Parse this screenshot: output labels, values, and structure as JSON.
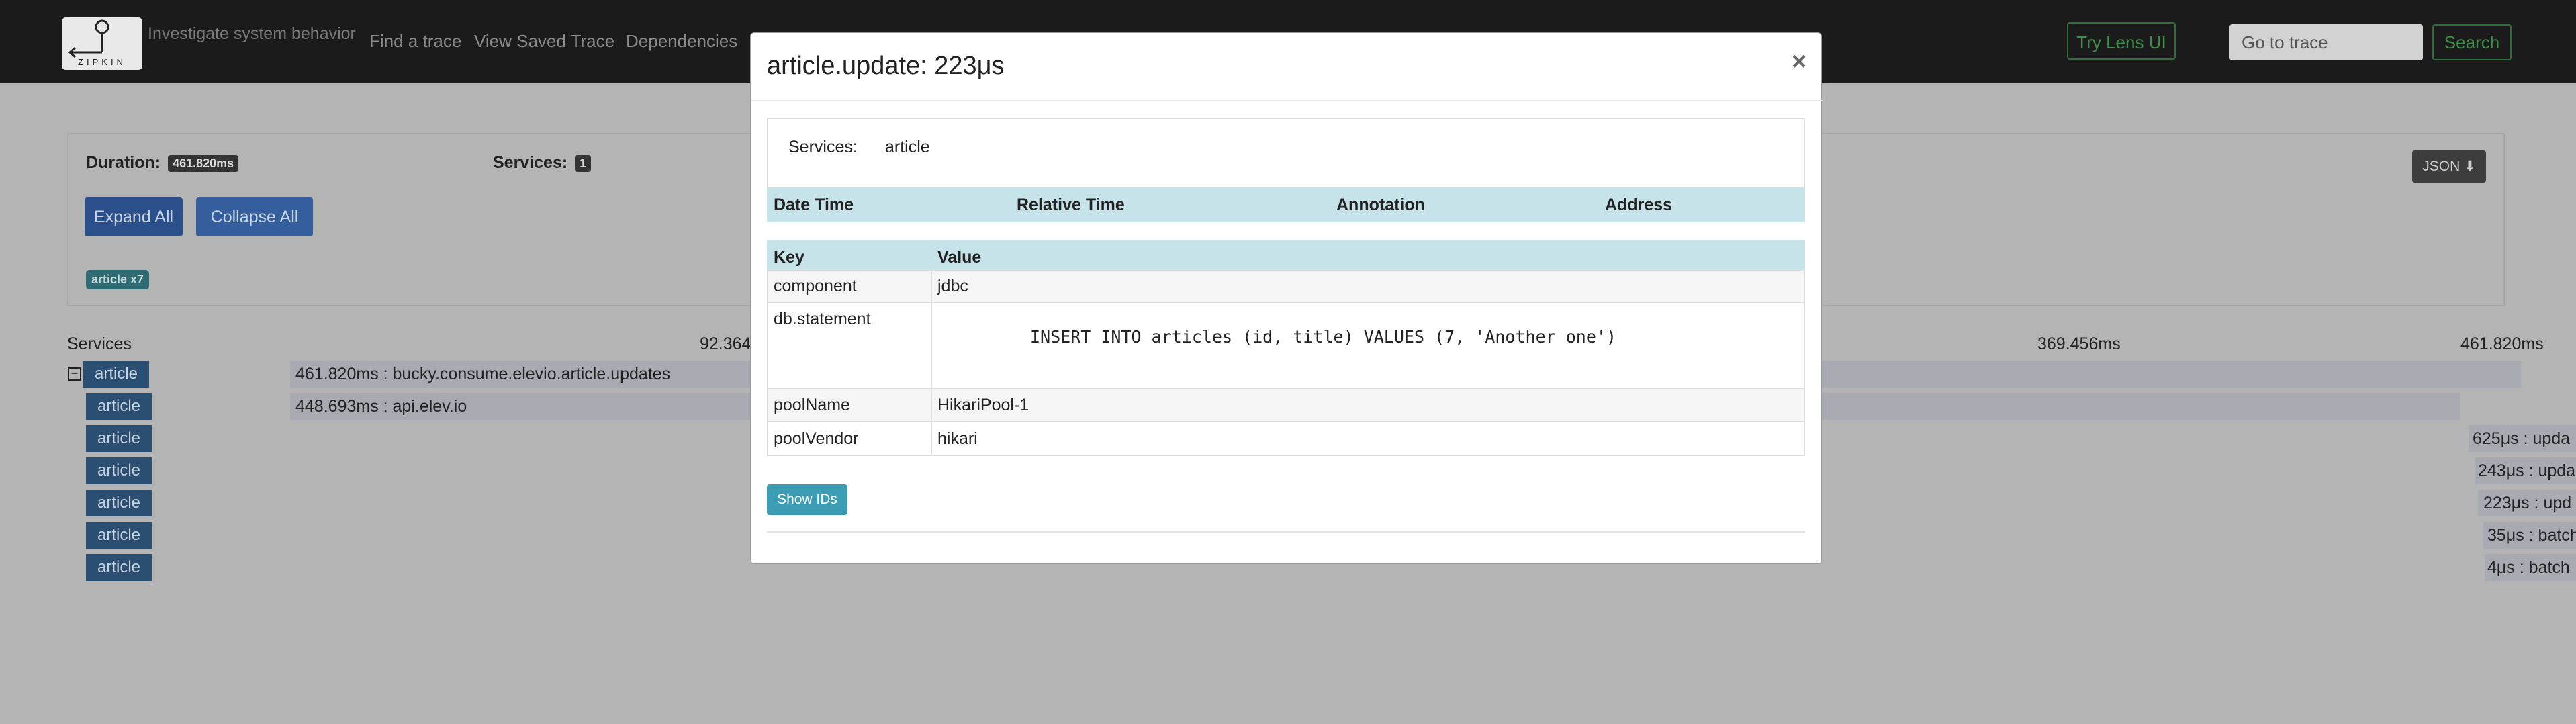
{
  "header": {
    "logo_text": "ZIPKIN",
    "tagline": "Investigate system behavior",
    "nav": [
      "Find a trace",
      "View Saved Trace",
      "Dependencies"
    ],
    "try_lens_label": "Try Lens UI",
    "goto_placeholder": "Go to trace",
    "search_label": "Search"
  },
  "summary": {
    "duration_label": "Duration:",
    "duration_value": "461.820ms",
    "services_label": "Services:",
    "services_value": "1",
    "expand_all_label": "Expand All",
    "collapse_all_label": "Collapse All",
    "service_badge": "article x7",
    "json_label": "JSON"
  },
  "timeline": {
    "services_header": "Services",
    "ticks": [
      "92.364",
      "369.456ms",
      "461.820ms"
    ],
    "rows": [
      {
        "service": "article",
        "text": "461.820ms : bucky.consume.elevio.article.updates"
      },
      {
        "service": "article",
        "text": "448.693ms : api.elev.io"
      },
      {
        "service": "article",
        "text": "625μs : upda"
      },
      {
        "service": "article",
        "text": "243μs : upda"
      },
      {
        "service": "article",
        "text": "223μs : upd"
      },
      {
        "service": "article",
        "text": "35μs : batch"
      },
      {
        "service": "article",
        "text": "4μs : batch"
      }
    ]
  },
  "modal": {
    "title": "article.update: 223μs",
    "close": "×",
    "services_key": "Services:",
    "services_value": "article",
    "annotation_headers": [
      "Date Time",
      "Relative Time",
      "Annotation",
      "Address"
    ],
    "tag_headers": [
      "Key",
      "Value"
    ],
    "tags": [
      {
        "key": "component",
        "value": "jdbc"
      },
      {
        "key": "db.statement",
        "value": "INSERT INTO articles (id, title) VALUES (7, 'Another one')"
      },
      {
        "key": "poolName",
        "value": "HikariPool-1"
      },
      {
        "key": "poolVendor",
        "value": "hikari"
      }
    ],
    "show_ids_label": "Show IDs"
  }
}
